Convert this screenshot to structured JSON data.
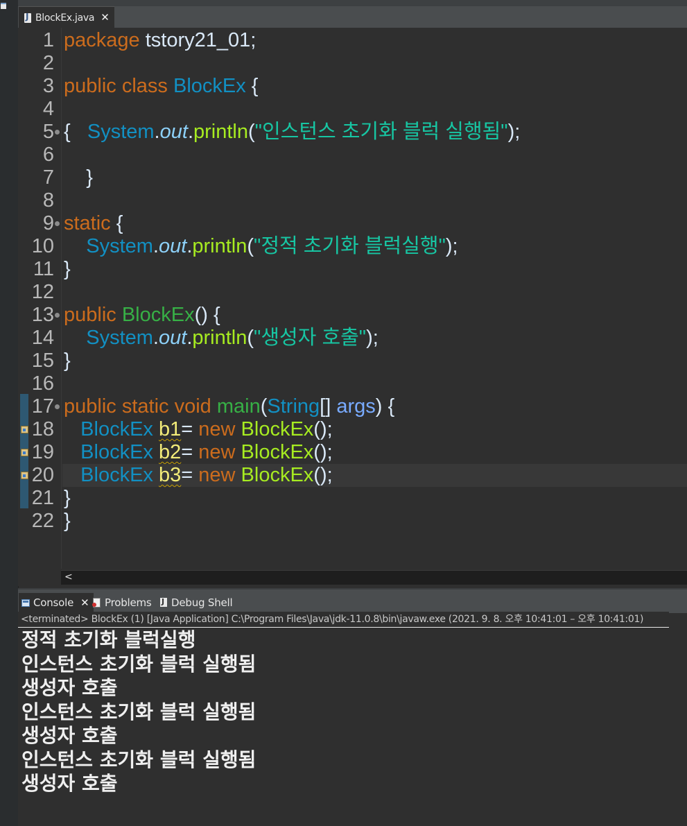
{
  "editor": {
    "tab_label": "BlockEx.java",
    "lines": [
      {
        "num": "1",
        "tokens": [
          {
            "t": "package",
            "c": "kw"
          },
          {
            "t": " tstory21_01;",
            "c": "plain"
          }
        ]
      },
      {
        "num": "2",
        "tokens": []
      },
      {
        "num": "3",
        "tokens": [
          {
            "t": "public",
            "c": "kw"
          },
          {
            "t": " ",
            "c": "plain"
          },
          {
            "t": "class",
            "c": "kw"
          },
          {
            "t": " ",
            "c": "plain"
          },
          {
            "t": "BlockEx",
            "c": "cls"
          },
          {
            "t": " {",
            "c": "plain"
          }
        ]
      },
      {
        "num": "4",
        "tokens": []
      },
      {
        "num": "5",
        "fold": true,
        "tokens": [
          {
            "t": "{   ",
            "c": "plain"
          },
          {
            "t": "System",
            "c": "cls"
          },
          {
            "t": ".",
            "c": "plain"
          },
          {
            "t": "out",
            "c": "ital"
          },
          {
            "t": ".",
            "c": "plain"
          },
          {
            "t": "println",
            "c": "method"
          },
          {
            "t": "(",
            "c": "plain"
          },
          {
            "t": "\"인스턴스 초기화 블럭 실행됨\"",
            "c": "str"
          },
          {
            "t": ");",
            "c": "plain"
          }
        ]
      },
      {
        "num": "6",
        "tokens": []
      },
      {
        "num": "7",
        "tokens": [
          {
            "t": "    }",
            "c": "plain"
          }
        ]
      },
      {
        "num": "8",
        "tokens": []
      },
      {
        "num": "9",
        "fold": true,
        "tokens": [
          {
            "t": "static",
            "c": "kw"
          },
          {
            "t": " {",
            "c": "plain"
          }
        ]
      },
      {
        "num": "10",
        "tokens": [
          {
            "t": "    ",
            "c": "plain"
          },
          {
            "t": "System",
            "c": "cls"
          },
          {
            "t": ".",
            "c": "plain"
          },
          {
            "t": "out",
            "c": "ital"
          },
          {
            "t": ".",
            "c": "plain"
          },
          {
            "t": "println",
            "c": "method"
          },
          {
            "t": "(",
            "c": "plain"
          },
          {
            "t": "\"정적 초기화 블럭실행\"",
            "c": "str"
          },
          {
            "t": ");",
            "c": "plain"
          }
        ]
      },
      {
        "num": "11",
        "tokens": [
          {
            "t": "}",
            "c": "plain"
          }
        ]
      },
      {
        "num": "12",
        "tokens": []
      },
      {
        "num": "13",
        "fold": true,
        "tokens": [
          {
            "t": "public",
            "c": "kw"
          },
          {
            "t": " ",
            "c": "plain"
          },
          {
            "t": "BlockEx",
            "c": "ctor"
          },
          {
            "t": "() {",
            "c": "plain"
          }
        ]
      },
      {
        "num": "14",
        "tokens": [
          {
            "t": "    ",
            "c": "plain"
          },
          {
            "t": "System",
            "c": "cls"
          },
          {
            "t": ".",
            "c": "plain"
          },
          {
            "t": "out",
            "c": "ital"
          },
          {
            "t": ".",
            "c": "plain"
          },
          {
            "t": "println",
            "c": "method"
          },
          {
            "t": "(",
            "c": "plain"
          },
          {
            "t": "\"생성자 호출\"",
            "c": "str"
          },
          {
            "t": ");",
            "c": "plain"
          }
        ]
      },
      {
        "num": "15",
        "tokens": [
          {
            "t": "}",
            "c": "plain"
          }
        ]
      },
      {
        "num": "16",
        "tokens": []
      },
      {
        "num": "17",
        "fold": true,
        "tokens": [
          {
            "t": "public",
            "c": "kw"
          },
          {
            "t": " ",
            "c": "plain"
          },
          {
            "t": "static",
            "c": "kw"
          },
          {
            "t": " ",
            "c": "plain"
          },
          {
            "t": "void",
            "c": "kw"
          },
          {
            "t": " ",
            "c": "plain"
          },
          {
            "t": "main",
            "c": "ctor"
          },
          {
            "t": "(",
            "c": "plain"
          },
          {
            "t": "String",
            "c": "cls"
          },
          {
            "t": "[] ",
            "c": "plain"
          },
          {
            "t": "args",
            "c": "param"
          },
          {
            "t": ") {",
            "c": "plain"
          }
        ]
      },
      {
        "num": "18",
        "warn": true,
        "tokens": [
          {
            "t": "   ",
            "c": "plain"
          },
          {
            "t": "BlockEx",
            "c": "cls"
          },
          {
            "t": " ",
            "c": "plain"
          },
          {
            "t": "b1",
            "c": "local"
          },
          {
            "t": "= ",
            "c": "plain"
          },
          {
            "t": "new",
            "c": "kw"
          },
          {
            "t": " ",
            "c": "plain"
          },
          {
            "t": "BlockEx",
            "c": "method"
          },
          {
            "t": "();",
            "c": "plain"
          }
        ]
      },
      {
        "num": "19",
        "warn": true,
        "tokens": [
          {
            "t": "   ",
            "c": "plain"
          },
          {
            "t": "BlockEx",
            "c": "cls"
          },
          {
            "t": " ",
            "c": "plain"
          },
          {
            "t": "b2",
            "c": "local"
          },
          {
            "t": "= ",
            "c": "plain"
          },
          {
            "t": "new",
            "c": "kw"
          },
          {
            "t": " ",
            "c": "plain"
          },
          {
            "t": "BlockEx",
            "c": "method"
          },
          {
            "t": "();",
            "c": "plain"
          }
        ]
      },
      {
        "num": "20",
        "warn": true,
        "current": true,
        "tokens": [
          {
            "t": "   ",
            "c": "plain"
          },
          {
            "t": "BlockEx",
            "c": "cls"
          },
          {
            "t": " ",
            "c": "plain"
          },
          {
            "t": "b3",
            "c": "local"
          },
          {
            "t": "= ",
            "c": "plain"
          },
          {
            "t": "new",
            "c": "kw"
          },
          {
            "t": " ",
            "c": "plain"
          },
          {
            "t": "BlockEx",
            "c": "method"
          },
          {
            "t": "();",
            "c": "plain"
          }
        ]
      },
      {
        "num": "21",
        "tokens": [
          {
            "t": "}",
            "c": "plain"
          }
        ]
      },
      {
        "num": "22",
        "tokens": [
          {
            "t": "}",
            "c": "plain"
          }
        ]
      }
    ],
    "hscroll_arrow": "<"
  },
  "console": {
    "tabs": [
      {
        "label": "Console",
        "icon": "console-icon",
        "active": true
      },
      {
        "label": "Problems",
        "icon": "problems-icon",
        "active": false
      },
      {
        "label": "Debug Shell",
        "icon": "debug-shell-icon",
        "active": false
      }
    ],
    "close_glyph": "✕",
    "status": "<terminated> BlockEx (1) [Java Application] C:\\Program Files\\Java\\jdk-11.0.8\\bin\\javaw.exe  (2021. 9. 8. 오후 10:41:01 – 오후 10:41:01)",
    "output": [
      "정적 초기화 블럭실행",
      "인스턴스 초기화 블럭 실행됨",
      "생성자 호출",
      "인스턴스 초기화 블럭 실행됨",
      "생성자 호출",
      "인스턴스 초기화 블럭 실행됨",
      "생성자 호출"
    ]
  },
  "colors": {
    "keyword": "#cc6c1d",
    "class": "#1290c3",
    "method": "#a7ec21",
    "string": "#17c6a3",
    "local": "#f3ec79",
    "background": "#2f2f2f"
  }
}
